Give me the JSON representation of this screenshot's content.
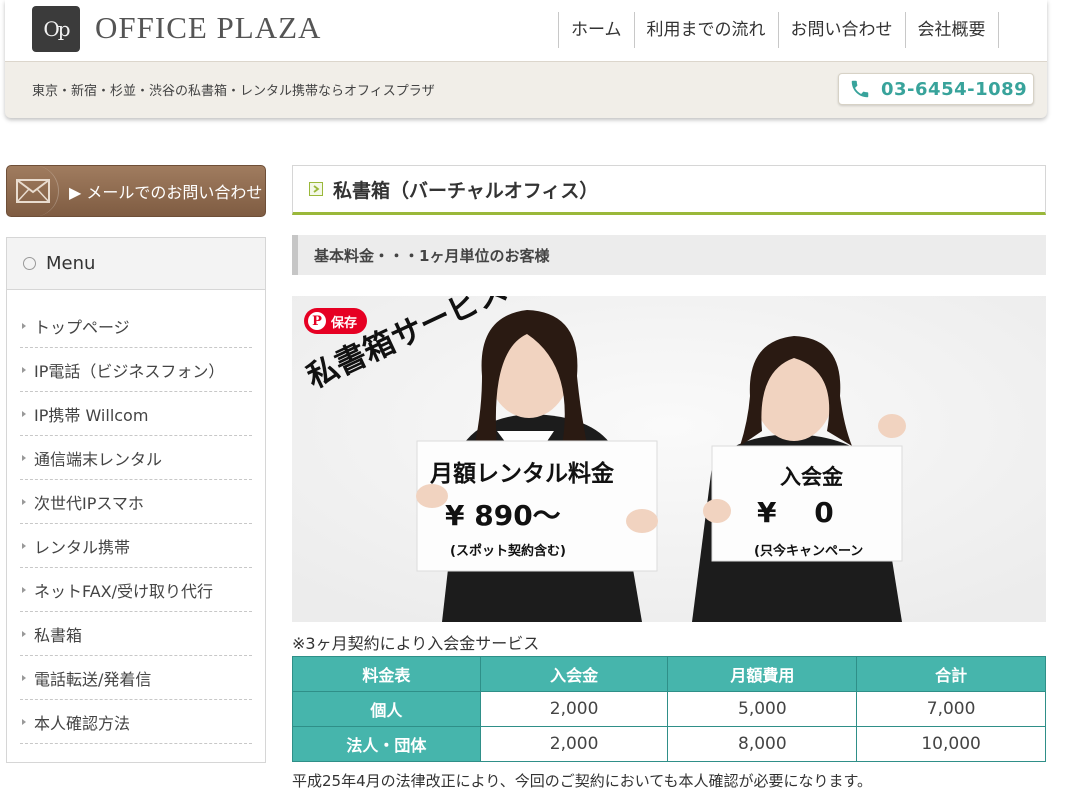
{
  "header": {
    "logo_mark": "Op",
    "logo_text": "OFFICE PLAZA",
    "nav": [
      "ホーム",
      "利用までの流れ",
      "お問い合わせ",
      "会社概要"
    ],
    "tagline": "東京・新宿・杉並・渋谷の私書箱・レンタル携帯ならオフィスプラザ",
    "phone": "03-6454-1089",
    "phone_color": "#38a39b"
  },
  "sidebar": {
    "mail_button": "▶ メールでのお問い合わせ",
    "menu_title": "Menu",
    "items": [
      "トップページ",
      "IP電話（ビジネスフォン）",
      "IP携帯 Willcom",
      "通信端末レンタル",
      "次世代IPスマホ",
      "レンタル携帯",
      "ネットFAX/受け取り代行",
      "私書箱",
      "電話転送/発着信",
      "本人確認方法"
    ]
  },
  "main": {
    "title": "私書箱（バーチャルオフィス）",
    "subtitle": "基本料金・・・1ヶ月単位のお客様",
    "banner": {
      "save_label": "保存",
      "heading": "私書箱サービス",
      "sign1_title": "月額レンタル料金",
      "sign1_price": "¥ 890～",
      "sign1_note": "(スポット契約含む)",
      "sign2_title": "入会金",
      "sign2_price": "¥　 0",
      "sign2_note": "(只今キャンペーン"
    },
    "note": "※3ヶ月契約により入会金サービス",
    "table": {
      "headers": [
        "料金表",
        "入会金",
        "月額費用",
        "合計"
      ],
      "rows": [
        [
          "個人",
          "2,000",
          "5,000",
          "7,000"
        ],
        [
          "法人・団体",
          "2,000",
          "8,000",
          "10,000"
        ]
      ]
    },
    "bottom_text": "平成25年4月の法律改正により、今回のご契約においても本人確認が必要になります。"
  },
  "colors": {
    "accent_green": "#9ab83a",
    "table_teal": "#46b5ac",
    "mail_brown": "#8b6a4f"
  }
}
